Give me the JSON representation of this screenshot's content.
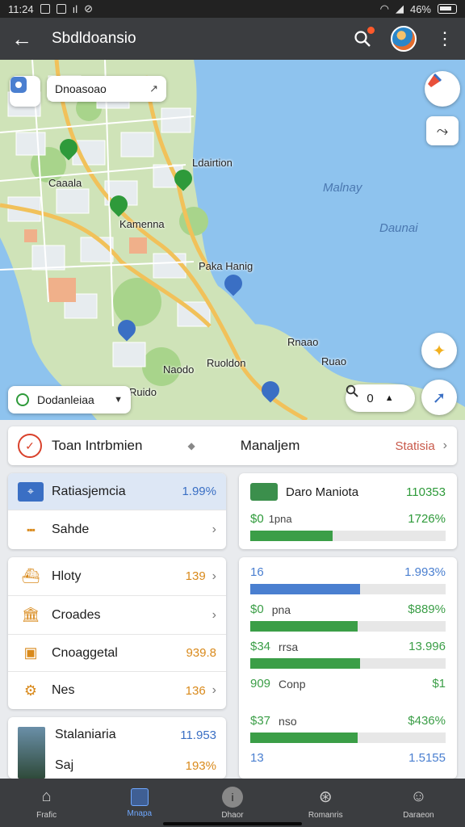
{
  "status_bar": {
    "time": "11:24",
    "battery": "46%"
  },
  "app_bar": {
    "title": "Sbdldoansio"
  },
  "map": {
    "search_chip": "Dnoasoao",
    "layer_chip": "Dodanleiaa",
    "place_labels": [
      "Caaala",
      "Ldairtion",
      "Kamenna",
      "Paka Hanig",
      "Rnaao",
      "Ruoldon",
      "Naodo",
      "Ruao",
      "Ruido"
    ],
    "water_labels": [
      "Malnay",
      "Daunai"
    ],
    "zoom_readout": "0"
  },
  "panel": {
    "header": {
      "title": "Toan Intrbmien",
      "middle": "Manaljem",
      "link": "Statisia"
    },
    "left_cards": [
      {
        "rows": [
          {
            "label": "Ratiasjemcia",
            "value": "1.99%",
            "icon": "route-icon"
          },
          {
            "label": "Sahde",
            "value": "",
            "icon": "dots-icon"
          }
        ]
      },
      {
        "rows": [
          {
            "label": "Hloty",
            "value": "139",
            "icon": "ship-icon"
          },
          {
            "label": "Croades",
            "value": "",
            "icon": "building-icon"
          },
          {
            "label": "Cnoaggetal",
            "value": "939.8",
            "icon": "store-icon"
          },
          {
            "label": "Nes",
            "value": "136",
            "icon": "gear-pin-icon"
          }
        ]
      },
      {
        "rows": [
          {
            "label": "Stalaniaria",
            "value": "11.953"
          },
          {
            "label": "Saj",
            "value": "193%"
          }
        ]
      }
    ],
    "right_cards": [
      {
        "title": "Daro Maniota",
        "title_value": "110353",
        "stat_label": "$0",
        "stat_sub": "1pna",
        "stat_value": "1726%",
        "fill": 0.42
      },
      {
        "stats": [
          {
            "label": "16",
            "sub": "",
            "value": "1.993%",
            "fill": 0.56,
            "color": "#4a7fd0"
          },
          {
            "label": "$0",
            "sub": "pna",
            "value": "$889%",
            "fill": 0.55,
            "color": "#3b9e47"
          },
          {
            "label": "$34",
            "sub": "rrsa",
            "value": "13.996",
            "fill": 0.56,
            "color": "#3b9e47"
          },
          {
            "label": "909",
            "sub": "Conp",
            "value": "$1",
            "fill": 0,
            "color": "#3b9e47"
          },
          {
            "label": "$37",
            "sub": "nso",
            "value": "$436%",
            "fill": 0.55,
            "color": "#3b9e47"
          },
          {
            "label": "13",
            "sub": "",
            "value": "1.5155",
            "fill": 0,
            "color": "#4a7fd0"
          }
        ]
      }
    ]
  },
  "bottom_nav": [
    {
      "label": "Frafic",
      "icon": "home-icon"
    },
    {
      "label": "Mnapa",
      "icon": "map-icon"
    },
    {
      "label": "Dhaor",
      "icon": "info-icon"
    },
    {
      "label": "Romanris",
      "icon": "compass-icon"
    },
    {
      "label": "Daraeon",
      "icon": "profile-icon"
    }
  ]
}
